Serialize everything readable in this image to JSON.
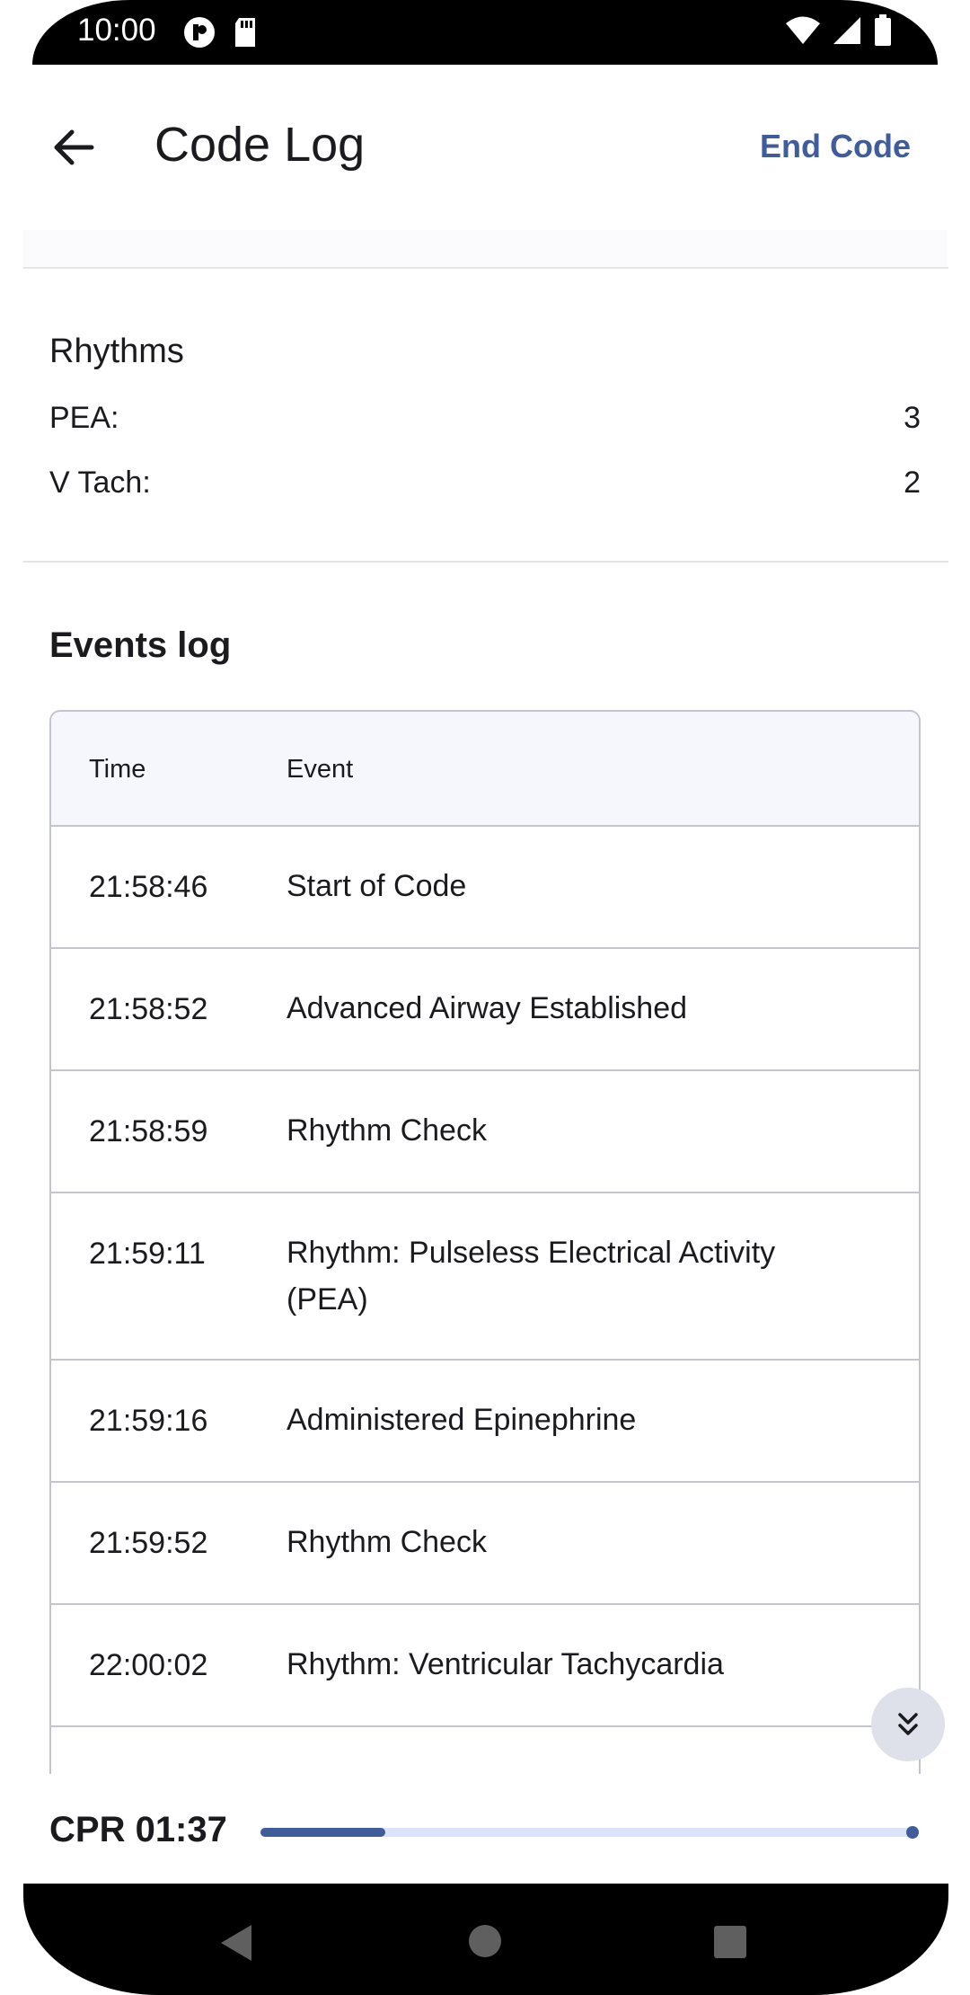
{
  "status_bar": {
    "time": "10:00"
  },
  "app_bar": {
    "title": "Code Log",
    "end_code_label": "End Code"
  },
  "rhythms": {
    "title": "Rhythms",
    "items": [
      {
        "label": "PEA:",
        "value": "3"
      },
      {
        "label": "V Tach:",
        "value": "2"
      }
    ]
  },
  "events": {
    "title": "Events log",
    "columns": [
      "Time",
      "Event"
    ],
    "rows": [
      {
        "time": "21:58:46",
        "event": "Start of Code"
      },
      {
        "time": "21:58:52",
        "event": "Advanced Airway Established"
      },
      {
        "time": "21:58:59",
        "event": "Rhythm Check"
      },
      {
        "time": "21:59:11",
        "event": "Rhythm: Pulseless Electrical Activity (PEA)"
      },
      {
        "time": "21:59:16",
        "event": "Administered Epinephrine"
      },
      {
        "time": "21:59:52",
        "event": "Rhythm Check"
      },
      {
        "time": "22:00:02",
        "event": "Rhythm: Ventricular Tachycardia"
      }
    ]
  },
  "cpr": {
    "label": "CPR 01:37",
    "progress_fraction": 0.19
  },
  "colors": {
    "accent": "#3f5d9a",
    "track": "#dbe3fb",
    "table_header_bg": "#f6f7fd"
  }
}
